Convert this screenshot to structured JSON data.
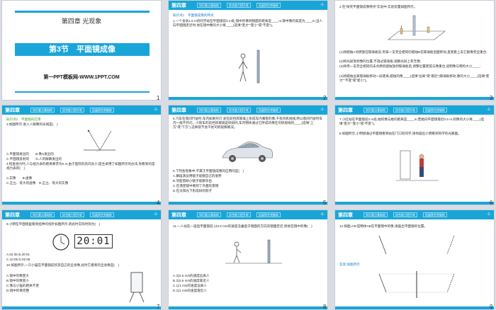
{
  "slide1": {
    "chapter": "第四章 光现象",
    "title": "第3节　平面镜成像",
    "site": "第一PPT模板网-WWW.1PPT.COM",
    "num": "1"
  },
  "header": {
    "chapter": "第四章",
    "tabs": [
      "知识要点基础练",
      "综合能力提升练",
      "拓展探究突破练"
    ],
    "page": "-1-"
  },
  "slide2": {
    "section": "知识点1　平面镜成像的特点",
    "q1": "1.一个身高1.8 m的同学站在平面镜前3 m处,镜中的像到镜面的距离是____m,镜中像的高度为____m;当人向平面镜走近时,他在镜中像的大小将____(选填\"变大\"\"变小\"或\"不变\")。",
    "num": "2"
  },
  "slide3": {
    "q2": "2.在\"探究平面镜成像特点\"实验中,实验装置如图所示。",
    "items": [
      "(1)将蜡烛A点燃放在玻璃板前,另拿一支完全相同的蜡烛B在玻璃板后面移动,直到看上去它跟像完全重合;",
      "(2)将光屏放到像的位置,不透过玻璃板,观察光屏上有无像;",
      "(3)将另一支完全相同的未点燃的蜡烛放到玻璃板后,调整位置使其与像重合,说明像与物的大小____;",
      "(4)将蜡烛远离玻璃板移动一段距离,蜡烛的像____(选填\"远离\"或\"靠近\")玻璃板移动,像的大小____(选填\"变大\"\"不变\"或\"变小\")。"
    ],
    "num": "3"
  },
  "slide4": {
    "section": "知识点2　平面镜的应用",
    "q3": "3.如图所示,进入人眼睛的光线是(　)",
    "opts": [
      "A.平面镜发出的　　B.像S发出的",
      "C.平面镜反射的　　D.人的眼睛发出的"
    ],
    "q4": "4.检查视力时,人与视力表的距离要求为5 m,由于医院的房间太小,医生采用了如图所示的办法,你看到的是视力表的(　)",
    "opts2": [
      "A.实像　　B.虚像",
      "C.正立、等大的虚像　D.正立、等大的实像"
    ],
    "num": "4"
  },
  "slide5": {
    "q5": "5.汽车在夜间行驶时,车内如果开灯,会在前挡风玻璃上形成车内乘客的像,干扰司机视线,所以夜间行驶时车内一般不开灯。小轿车的前挡风玻璃是倾斜的,车内物体通过它所成的像在司机视线的____(选填\"上方\"或\"下方\"),这样就不会干扰司机观察路况。",
    "q6": "6.下列各现象中,不属于平面镜成像的应用的是(　)",
    "opts": [
      "A.舞蹈演员用镜子观察自己的姿势",
      "B.牙医借助小镜子观察牙齿",
      "C.在潜望镜中看到了外面的景物",
      "D.在太阳光下形成树的影子"
    ],
    "num": "5"
  },
  "slide6": {
    "q7": "7.小红站在平面镜前2 m处,她的像与她的距离是____m;若她向平面镜靠近0.5 m,则像的大小将____(选填\"变大\"\"变小\"或\"不变\")。",
    "q8": "8.如图所示,小明想通过平面镜看到站在门口的同学,请你画出小明看到同学的光路图。",
    "num": "6"
  },
  "slide7": {
    "q9": "9.小明在平面镜里看到挂钟的指针如图所示,则此时实际时刻为(　)",
    "clock": "20:01",
    "opts": [
      "A.02:35 B.20:01",
      "C.10:05 D.02:05"
    ],
    "q10": "10.如图所示,一只小猫在平面镜前欣赏自己的全身像,此时它看到的全身像是(　)",
    "opts2": [
      "A.镜中的像变大",
      "B.镜中的像变小",
      "C.像与小猫的距离不变",
      "D.镜中的像完整"
    ],
    "num": "7"
  },
  "slide8": {
    "q11": "11.一人站在一竖直平面镜前,以0.5 m/s的速度沿垂直于镜面的方向向镜面走近,则他在镜中的像(　)",
    "opts": [
      "A.以0.5 m/s的速度远离人",
      "B.以0.5 m/s的速度靠近人",
      "C.以1 m/s的速度远离人",
      "D.以1 m/s的速度靠近人"
    ],
    "num": "8"
  },
  "slide9": {
    "q12": "12.如图,A′B′是物体AB在平面镜中的像,请画出平面镜的位置。",
    "answer": "答案:如图所示",
    "num": "9"
  }
}
